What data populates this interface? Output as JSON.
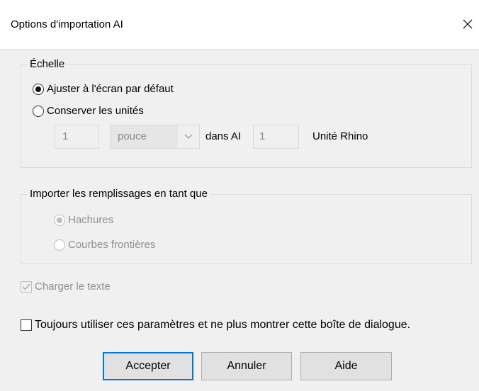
{
  "window": {
    "title": "Options d'importation AI"
  },
  "scale_group": {
    "legend": "Échelle",
    "option_fit": "Ajuster à l'écran par défaut",
    "option_keep": "Conserver les unités",
    "value_left": "1",
    "unit_select": "pouce",
    "label_in_ai": "dans AI",
    "value_right": "1",
    "label_rhino": "Unité Rhino"
  },
  "fill_group": {
    "legend": "Importer les remplissages en tant que",
    "option_hatch": "Hachures",
    "option_boundary": "Courbes frontières"
  },
  "load_text": {
    "label": "Charger le texte",
    "checked": true
  },
  "always_use": {
    "label": "Toujours utiliser ces paramètres et ne plus montrer cette boîte de dialogue.",
    "checked": false
  },
  "buttons": {
    "accept": "Accepter",
    "cancel": "Annuler",
    "help": "Aide"
  },
  "icons": {
    "close": "close-icon",
    "chevron": "chevron-down-icon",
    "check": "check-icon"
  }
}
